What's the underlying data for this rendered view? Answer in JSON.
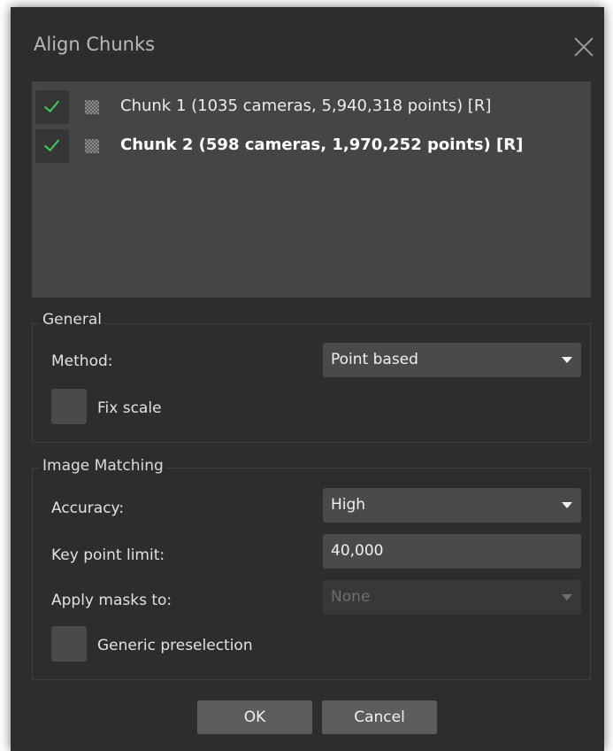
{
  "dialog": {
    "title": "Align Chunks"
  },
  "chunks": [
    {
      "label": "Chunk 1 (1035 cameras, 5,940,318 points) [R]",
      "checked": true,
      "active": false
    },
    {
      "label": "Chunk 2 (598 cameras, 1,970,252 points) [R]",
      "checked": true,
      "active": true
    }
  ],
  "general": {
    "title": "General",
    "method_label": "Method:",
    "method_value": "Point based",
    "fix_scale_label": "Fix scale"
  },
  "image_matching": {
    "title": "Image Matching",
    "accuracy_label": "Accuracy:",
    "accuracy_value": "High",
    "key_point_label": "Key point limit:",
    "key_point_value": "40,000",
    "apply_masks_label": "Apply masks to:",
    "apply_masks_value": "None",
    "generic_preselection_label": "Generic preselection"
  },
  "buttons": {
    "ok": "OK",
    "cancel": "Cancel"
  },
  "colors": {
    "check": "#3bd15a",
    "background": "#2d2d2d",
    "list": "#454545"
  },
  "icons": {
    "close": "close-icon",
    "check": "checkmark-icon",
    "chunk": "chunk-grid-icon",
    "dropdown": "chevron-down-icon"
  }
}
